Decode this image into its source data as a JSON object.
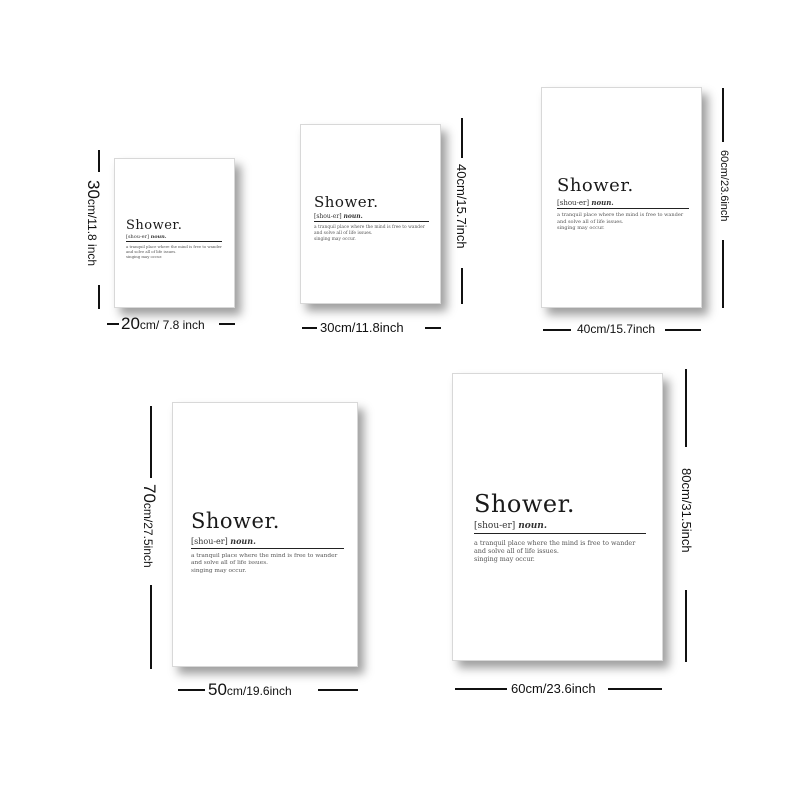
{
  "poster": {
    "title": "Shower.",
    "phonetic": "[shou-er]",
    "pos": "noun.",
    "definition": [
      "a tranquil place where the mind is free to wander",
      "and solve all of life issues.",
      "singing may occur."
    ]
  },
  "sizes": [
    {
      "width_value": "20",
      "width_unit": "cm/ 7.8 inch",
      "height_value": "30",
      "height_unit": "cm/11.8 inch"
    },
    {
      "width_label": "30cm/11.8inch",
      "height_label": "40cm/15.7inch"
    },
    {
      "width_label": "40cm/15.7inch",
      "height_label": "60cm/23.6inch"
    },
    {
      "width_value": "50",
      "width_unit": "cm/19.6inch",
      "height_value": "70",
      "height_unit": "cm/27.5inch"
    },
    {
      "width_label": "60cm/23.6inch",
      "height_label": "80cm/31.5inch"
    }
  ]
}
